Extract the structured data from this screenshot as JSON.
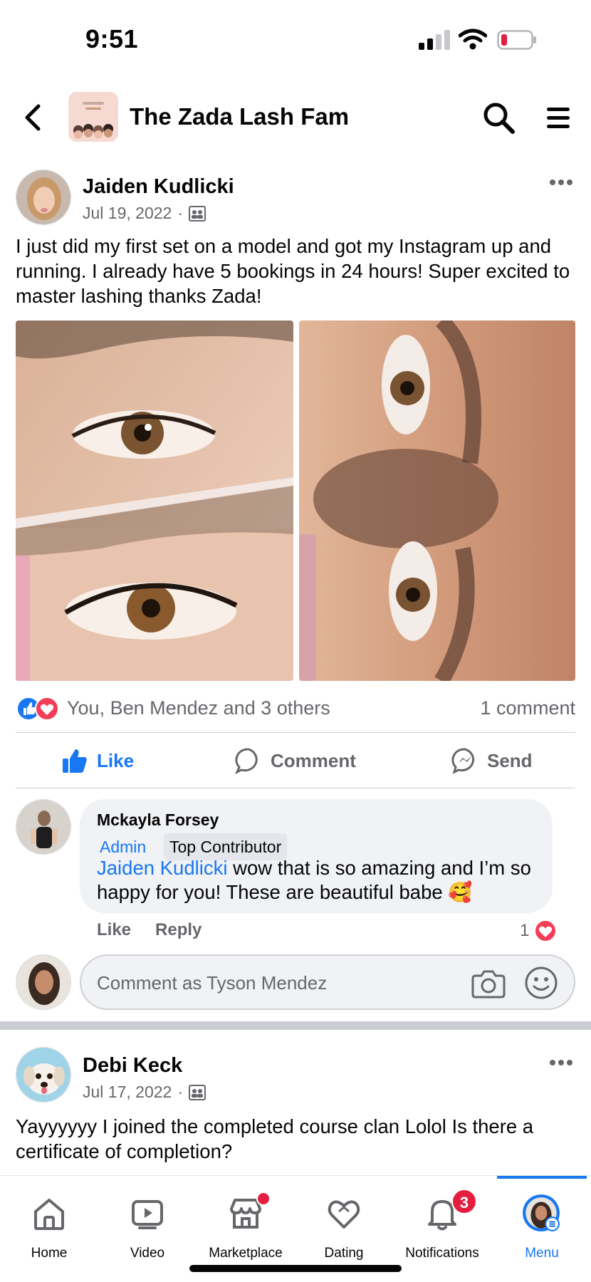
{
  "status": {
    "time": "9:51"
  },
  "header": {
    "title": "The Zada Lash Fam"
  },
  "post": {
    "author": "Jaiden Kudlicki",
    "date": "Jul 19, 2022",
    "separator": "·",
    "text": "I just did my first set on a model and got my Instagram up and running. I already have 5 bookings in 24 hours! Super excited to master lashing thanks Zada!",
    "reactions_text": "You, Ben Mendez and 3 others",
    "comments_count": "1 comment",
    "actions": {
      "like": "Like",
      "comment": "Comment",
      "send": "Send"
    }
  },
  "comment": {
    "author": "Mckayla Forsey",
    "badge_admin": "Admin",
    "badge_top": "Top Contributor",
    "mention": "Jaiden Kudlicki",
    "text": " wow that is so amazing and I’m so happy for you! These are beautiful babe 🥰",
    "like": "Like",
    "reply": "Reply",
    "reaction_count": "1"
  },
  "composer": {
    "placeholder": "Comment as Tyson Mendez"
  },
  "post2": {
    "author": "Debi Keck",
    "date": "Jul 17, 2022",
    "separator": "·",
    "text": "Yayyyyyy I joined the completed course clan Lolol Is there a certificate of completion?"
  },
  "nav": {
    "home": "Home",
    "video": "Video",
    "marketplace": "Marketplace",
    "dating": "Dating",
    "notifications": "Notifications",
    "notifications_badge": "3",
    "menu": "Menu"
  },
  "colors": {
    "accent": "#1877f2",
    "badge": "#e41e3f",
    "muted": "#65676b"
  }
}
